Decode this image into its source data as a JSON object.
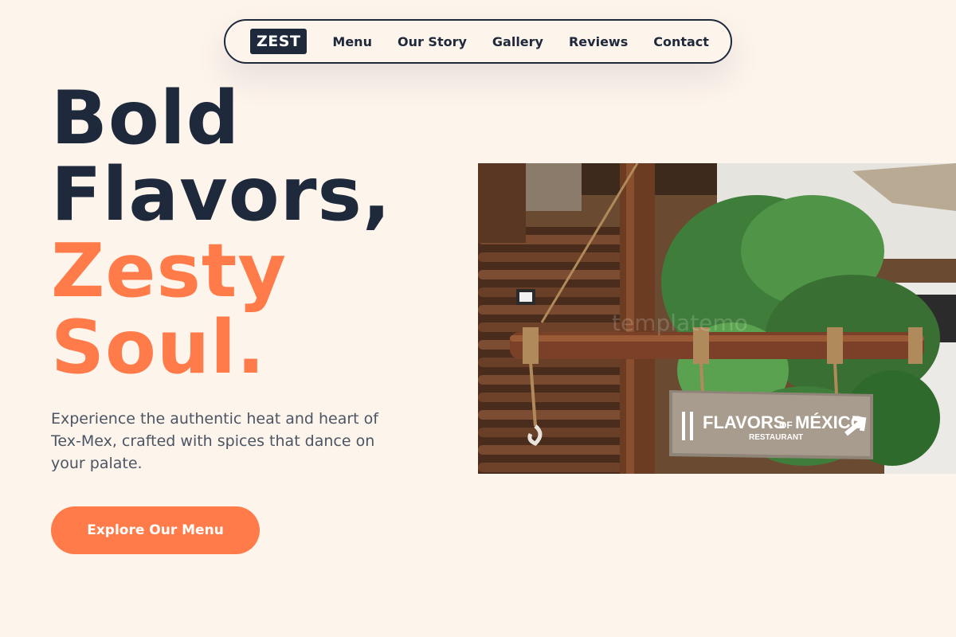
{
  "nav": {
    "logo": "ZEST",
    "links": [
      "Menu",
      "Our Story",
      "Gallery",
      "Reviews",
      "Contact"
    ]
  },
  "hero": {
    "title_line1": "Bold",
    "title_line2": "Flavors,",
    "title_line3": "Zesty",
    "title_line4": "Soul.",
    "subtitle": "Experience the authentic heat and heart of Tex-Mex, crafted with spices that dance on your palate.",
    "cta_label": "Explore Our Menu"
  },
  "image": {
    "sign_text": "FLAVORS",
    "sign_of": "OF",
    "sign_mexico": "MÉXICO",
    "sign_sub": "RESTAURANT",
    "watermark": "templatemo"
  },
  "colors": {
    "background": "#fdf4ec",
    "dark": "#1e293b",
    "accent": "#ff7b4a",
    "muted": "#4b5563"
  }
}
